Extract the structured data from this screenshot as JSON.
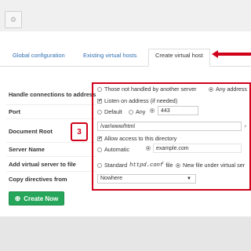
{
  "topbar": {
    "gear_icon": "gear-icon"
  },
  "tabs": [
    {
      "label": "Global configuration"
    },
    {
      "label": "Existing virtual hosts"
    },
    {
      "label": "Create virtual host"
    }
  ],
  "annotation": {
    "badge_number": "3",
    "color": "#d0021b"
  },
  "form": {
    "handle_connections": {
      "label": "Handle connections to address",
      "option_not_handled": "Those not handled by another server",
      "option_any": "Any address",
      "listen_checkbox": "Listen on address (if needed)"
    },
    "port": {
      "label": "Port",
      "option_default": "Default",
      "option_any": "Any",
      "value": "443"
    },
    "document_root": {
      "label": "Document Root",
      "value": "/var/www/html",
      "allow_checkbox": "Allow access to this directory",
      "browse_icon": "file-chooser-icon"
    },
    "server_name": {
      "label": "Server Name",
      "option_automatic": "Automatic",
      "value": "example.com"
    },
    "add_virtual_server": {
      "label": "Add virtual server to file",
      "option_standard_prefix": "Standard",
      "option_standard_code": "httpd.conf",
      "option_standard_suffix": "file",
      "option_new_file": "New file under virtual ser"
    },
    "copy_directives": {
      "label": "Copy directives from",
      "selected": "Nowhere"
    }
  },
  "create_button": {
    "label": "Create Now"
  }
}
